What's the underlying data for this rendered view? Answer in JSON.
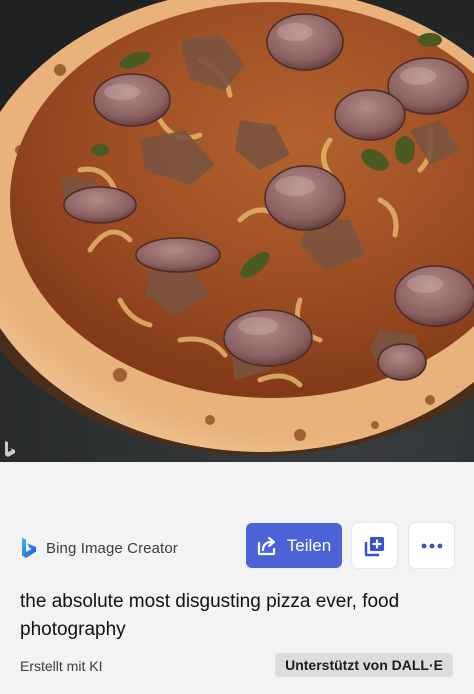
{
  "image": {
    "subject": "pizza"
  },
  "brand": {
    "name": "Bing Image Creator",
    "logo_icon": "bing-logo-icon"
  },
  "actions": {
    "share_label": "Teilen",
    "share_icon": "share-icon",
    "add_icon": "add-to-collection-icon",
    "more_icon": "more-options-icon"
  },
  "prompt": {
    "text": "the absolute most disgusting pizza ever, food photography"
  },
  "footer": {
    "created_with": "Erstellt mit KI",
    "powered_by": "Unterstützt von DALL·E"
  },
  "colors": {
    "accent": "#4b63d6",
    "panel_background": "#f3f3f5",
    "badge_background": "#dddde0"
  }
}
